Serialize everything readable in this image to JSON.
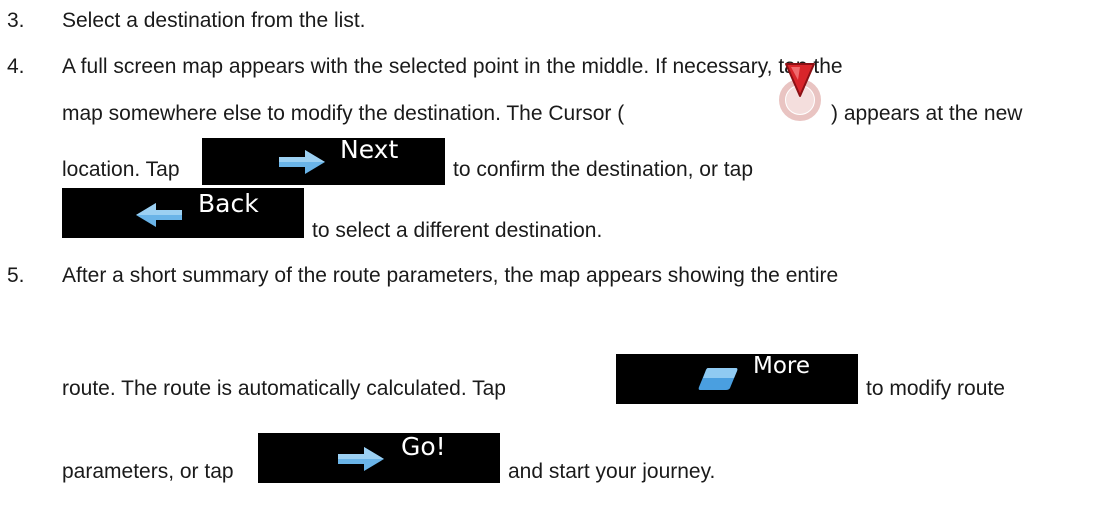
{
  "steps": [
    {
      "number": "3.",
      "line1": "Select a destination from the list."
    },
    {
      "number": "4.",
      "line1": "A full screen map appears with the selected point in the middle. If necessary, tap the",
      "line2a": "map somewhere else to modify the destination. The Cursor (",
      "line2b": ") appears at the new",
      "line3a": "location. Tap",
      "line3b": "to confirm the destination, or tap",
      "line4": "to select a different destination."
    },
    {
      "number": "5.",
      "line1": "After a short summary of the route parameters, the map appears showing the entire",
      "line2a": "route. The route is automatically calculated. Tap",
      "line2b": "to modify route",
      "line3a": "parameters, or tap",
      "line3b": "and start your journey."
    }
  ],
  "buttons": {
    "next": {
      "label": "Next",
      "icon": "arrow-right-icon"
    },
    "back": {
      "label": "Back",
      "icon": "arrow-left-icon"
    },
    "more": {
      "label": "More",
      "icon": "more-icon"
    },
    "go": {
      "label": "Go!",
      "icon": "arrow-right-icon"
    }
  },
  "colors": {
    "button_bg": "#000000",
    "button_text": "#ffffff",
    "icon_blue": "#6ab4e8",
    "cursor_red": "#d9252a"
  }
}
